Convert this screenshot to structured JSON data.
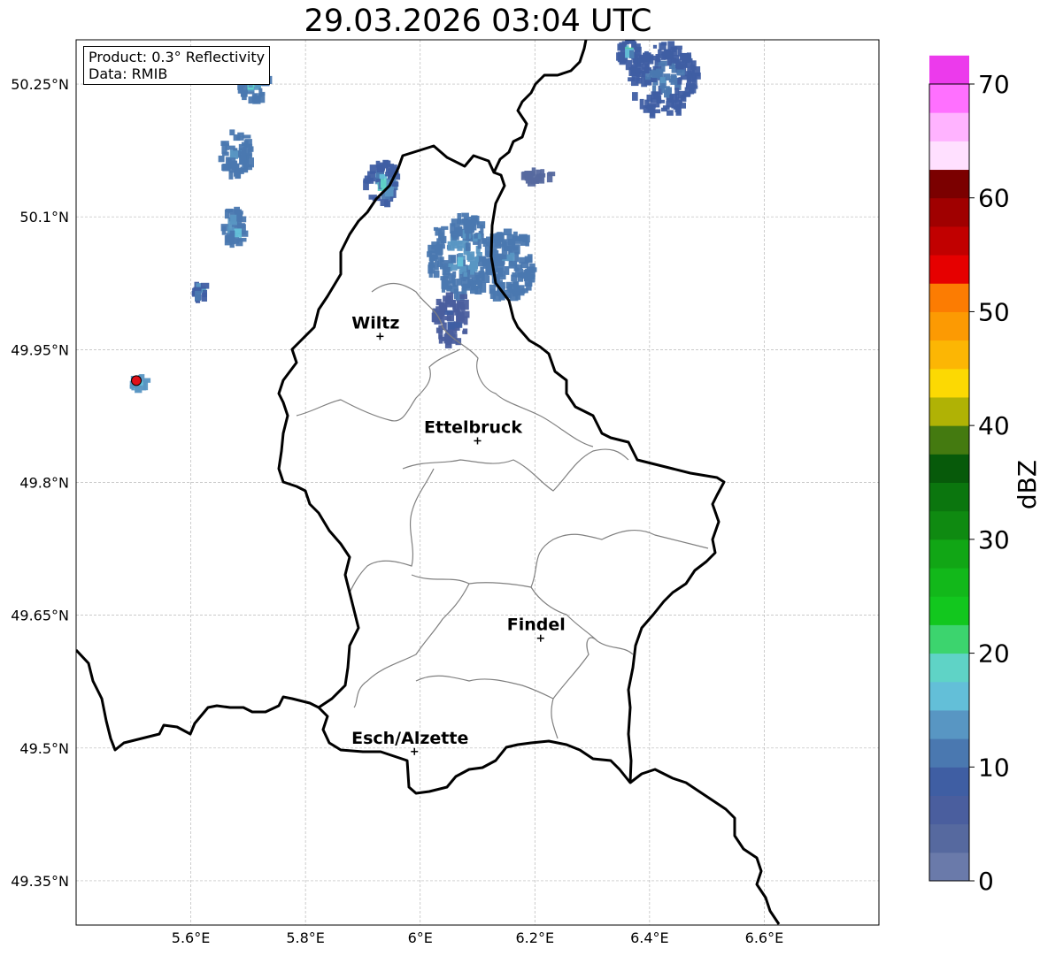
{
  "title": "29.03.2026 03:04 UTC",
  "info": {
    "product": "Product: 0.3° Reflectivity",
    "source": "Data: RMIB"
  },
  "map": {
    "extent": {
      "lon": [
        5.4,
        6.8
      ],
      "lat": [
        49.3,
        50.3
      ]
    },
    "lon_ticks": [
      {
        "v": 5.6,
        "label": "5.6°E"
      },
      {
        "v": 5.8,
        "label": "5.8°E"
      },
      {
        "v": 6.0,
        "label": "6°E"
      },
      {
        "v": 6.2,
        "label": "6.2°E"
      },
      {
        "v": 6.4,
        "label": "6.4°E"
      },
      {
        "v": 6.6,
        "label": "6.6°E"
      }
    ],
    "lat_ticks": [
      {
        "v": 50.25,
        "label": "50.25°N"
      },
      {
        "v": 50.1,
        "label": "50.1°N"
      },
      {
        "v": 49.95,
        "label": "49.95°N"
      },
      {
        "v": 49.8,
        "label": "49.8°N"
      },
      {
        "v": 49.65,
        "label": "49.65°N"
      },
      {
        "v": 49.5,
        "label": "49.5°N"
      },
      {
        "v": 49.35,
        "label": "49.35°N"
      }
    ],
    "grid": true
  },
  "cities": [
    {
      "name": "Wiltz",
      "lon": 5.93,
      "lat": 49.965
    },
    {
      "name": "Ettelbruck",
      "lon": 6.1,
      "lat": 49.847
    },
    {
      "name": "Findel",
      "lon": 6.21,
      "lat": 49.624
    },
    {
      "name": "Esch/Alzette",
      "lon": 5.99,
      "lat": 49.496
    }
  ],
  "radar_site": {
    "lon": 5.505,
    "lat": 49.915,
    "color": "#e0101a"
  },
  "echoes": [
    {
      "lon": 5.705,
      "lat": 50.255,
      "rx": 0.025,
      "ry": 0.022,
      "dbz": 12,
      "core": 22
    },
    {
      "lon": 5.675,
      "lat": 50.175,
      "rx": 0.03,
      "ry": 0.025,
      "dbz": 11,
      "core": 16
    },
    {
      "lon": 5.67,
      "lat": 50.092,
      "rx": 0.022,
      "ry": 0.02,
      "dbz": 10,
      "core": 24
    },
    {
      "lon": 5.61,
      "lat": 50.02,
      "rx": 0.012,
      "ry": 0.01,
      "dbz": 8,
      "core": 26
    },
    {
      "lon": 5.93,
      "lat": 50.14,
      "rx": 0.03,
      "ry": 0.025,
      "dbz": 9,
      "core": 24
    },
    {
      "lon": 6.07,
      "lat": 50.06,
      "rx": 0.06,
      "ry": 0.045,
      "dbz": 12,
      "core": 16
    },
    {
      "lon": 6.05,
      "lat": 49.99,
      "rx": 0.03,
      "ry": 0.03,
      "dbz": 6,
      "core": 10
    },
    {
      "lon": 6.15,
      "lat": 50.05,
      "rx": 0.045,
      "ry": 0.04,
      "dbz": 10,
      "core": 15
    },
    {
      "lon": 6.42,
      "lat": 50.26,
      "rx": 0.06,
      "ry": 0.04,
      "dbz": 9,
      "core": 15
    },
    {
      "lon": 6.36,
      "lat": 50.29,
      "rx": 0.02,
      "ry": 0.015,
      "dbz": 8,
      "core": 24
    },
    {
      "lon": 6.2,
      "lat": 50.15,
      "rx": 0.025,
      "ry": 0.008,
      "dbz": 3,
      "core": 5
    },
    {
      "lon": 5.505,
      "lat": 49.915,
      "rx": 0.014,
      "ry": 0.009,
      "dbz": 14,
      "core": 18
    }
  ],
  "colorbar": {
    "label": "dBZ",
    "min": 0,
    "max": 70,
    "step": 2.5,
    "ticks": [
      0,
      10,
      20,
      30,
      40,
      50,
      60,
      70
    ],
    "colors": [
      "#6a7aaa",
      "#56699f",
      "#4a5e9e",
      "#3f5ea3",
      "#4a78b0",
      "#5896c3",
      "#63bfd8",
      "#5fd3c6",
      "#3cd46e",
      "#12c71e",
      "#12b81a",
      "#11a615",
      "#0f8a11",
      "#0b760e",
      "#075a0a",
      "#447a10",
      "#b0b205",
      "#fcd903",
      "#fcb604",
      "#fc9a03",
      "#fc7c02",
      "#e60000",
      "#c10000",
      "#a00000",
      "#7b0000",
      "#ffe0ff",
      "#ffb3ff",
      "#ff70ff",
      "#ec3aec"
    ]
  }
}
